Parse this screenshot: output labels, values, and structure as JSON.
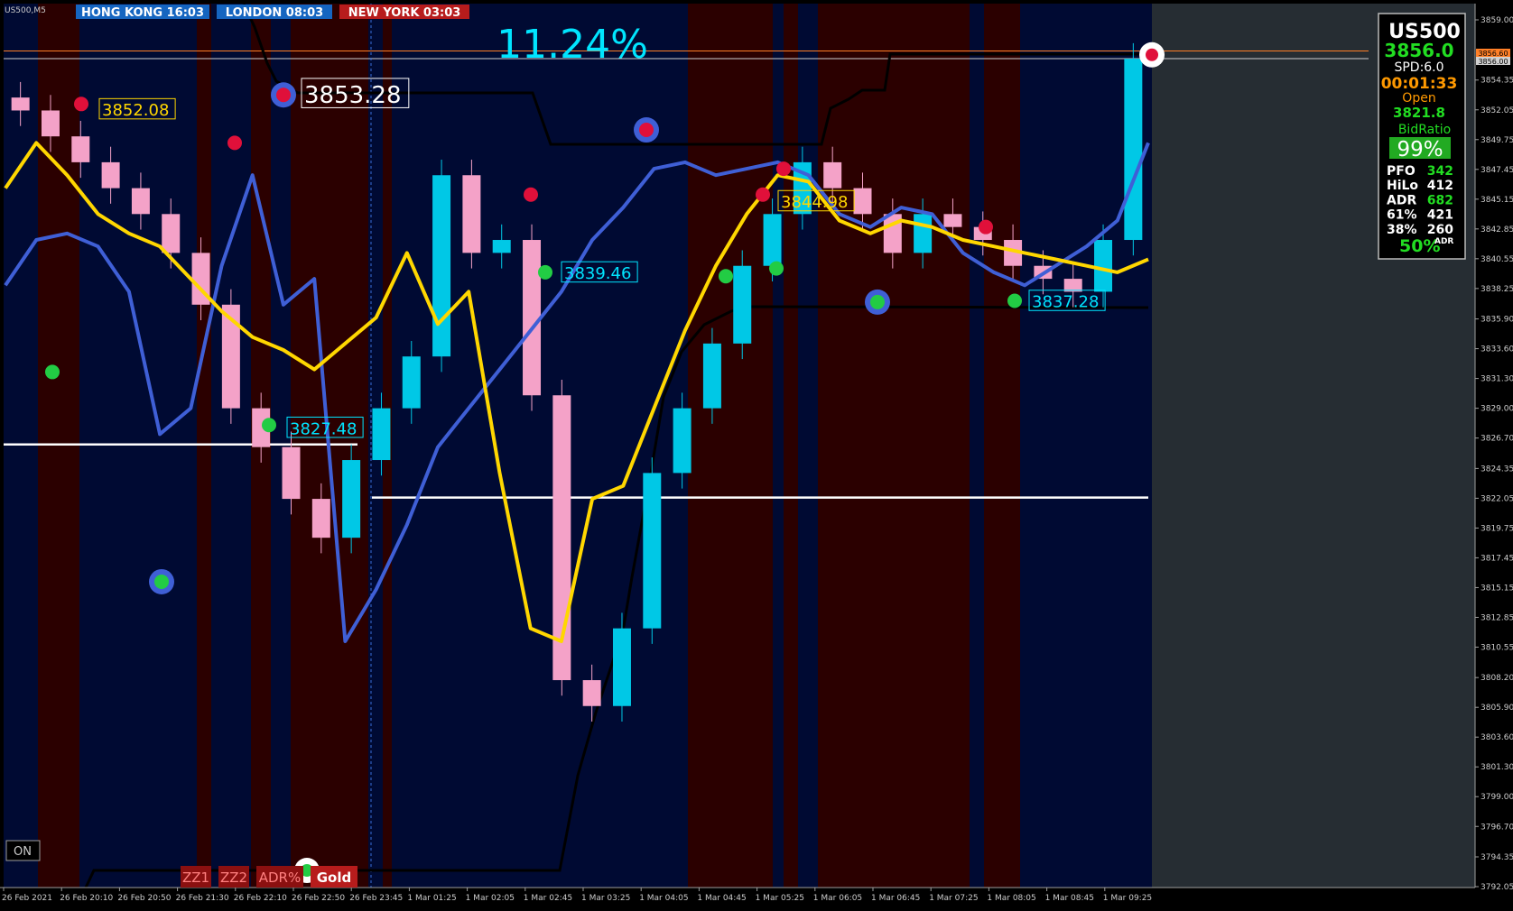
{
  "window": {
    "symbol_title": "US500,M5"
  },
  "sessions": [
    {
      "label": "HONG KONG 16:03",
      "color": "#1565c0"
    },
    {
      "label": "LONDON 08:03",
      "color": "#1565c0"
    },
    {
      "label": "NEW YORK 03:03",
      "color": "#b71c1c"
    }
  ],
  "big_percent": "11.24%",
  "info_panel": {
    "symbol": "US500",
    "price": "3856.0",
    "spread": "SPD:6.0",
    "timer": "00:01:33",
    "open_label": "Open",
    "open_value": "3821.8",
    "bidratio_label": "BidRatio",
    "bidratio_value": "99%",
    "rows": [
      {
        "label": "PFO",
        "value": "342"
      },
      {
        "label": "HiLo",
        "value": "412"
      },
      {
        "label": "ADR",
        "value": "682"
      },
      {
        "label": "61%",
        "value": "421"
      },
      {
        "label": "38%",
        "value": "260"
      }
    ],
    "adr_percent": "50%",
    "adr_sup": "ADR"
  },
  "buttons": {
    "on": "ON",
    "zz1": "ZZ1",
    "zz2": "ZZ2",
    "adr": "ADR%",
    "gold": "Gold"
  },
  "price_tags": [
    {
      "text": "3852.08",
      "color": "#ffd700"
    },
    {
      "text": "3853.28",
      "color": "#ffffff"
    },
    {
      "text": "3827.48",
      "color": "#00e5ff"
    },
    {
      "text": "3839.46",
      "color": "#00e5ff"
    },
    {
      "text": "3844.98",
      "color": "#ffd700"
    },
    {
      "text": "3837.28",
      "color": "#00e5ff"
    }
  ],
  "price_axis": {
    "labels": [
      "3859.00",
      "3856.60",
      "3856.00",
      "3854.35",
      "3852.05",
      "3849.75",
      "3847.45",
      "3845.15",
      "3842.85",
      "3840.55",
      "3838.25",
      "3835.90",
      "3833.60",
      "3831.30",
      "3829.00",
      "3826.70",
      "3824.35",
      "3822.05",
      "3819.75",
      "3817.45",
      "3815.15",
      "3812.85",
      "3810.55",
      "3808.20",
      "3805.90",
      "3803.60",
      "3801.30",
      "3799.00",
      "3796.70",
      "3794.35",
      "3792.05"
    ],
    "ask_tag": "3856.60",
    "bid_tag": "3856.00"
  },
  "time_axis": [
    "26 Feb 2021",
    "26 Feb 20:10",
    "26 Feb 20:50",
    "26 Feb 21:30",
    "26 Feb 22:10",
    "26 Feb 22:50",
    "26 Feb 23:45",
    "1 Mar 01:25",
    "1 Mar 02:05",
    "1 Mar 02:45",
    "1 Mar 03:25",
    "1 Mar 04:05",
    "1 Mar 04:45",
    "1 Mar 05:25",
    "1 Mar 06:05",
    "1 Mar 06:45",
    "1 Mar 07:25",
    "1 Mar 08:05",
    "1 Mar 08:45",
    "1 Mar 09:25"
  ],
  "chart_data": {
    "type": "candlestick",
    "ylim": [
      3792.05,
      3859.0
    ],
    "yellow_ma": [
      3846,
      3849.5,
      3847,
      3844,
      3842.5,
      3841.5,
      3839,
      3836.5,
      3834.5,
      3833.5,
      3832,
      3834,
      3836,
      3841,
      3835.5,
      3838,
      3824,
      3812,
      3811,
      3822,
      3823,
      3829,
      3835,
      3840,
      3844,
      3847,
      3846.5,
      3843.5,
      3842.5,
      3843.5,
      3843,
      3842,
      3841.5,
      3841,
      3840.5,
      3840,
      3839.5,
      3840.5
    ],
    "blue_ma": [
      3838.5,
      3842,
      3842.5,
      3841.5,
      3838,
      3827,
      3829,
      3840,
      3847,
      3837,
      3839,
      3811,
      3815,
      3820,
      3826,
      3829,
      3832,
      3835,
      3838,
      3842,
      3844.5,
      3847.5,
      3848,
      3847,
      3847.5,
      3848,
      3847,
      3844,
      3843,
      3844.5,
      3844,
      3841,
      3839.5,
      3838.5,
      3840,
      3841.5,
      3843.5,
      3849.5
    ],
    "closes": [
      3852,
      3850,
      3848,
      3846,
      3844,
      3841,
      3837,
      3829,
      3826,
      3822,
      3819,
      3825,
      3829,
      3833,
      3847,
      3841,
      3842,
      3830,
      3808,
      3806,
      3812,
      3824,
      3829,
      3834,
      3840,
      3844,
      3848,
      3846,
      3844,
      3841,
      3844,
      3843,
      3842,
      3840,
      3839,
      3838,
      3842,
      3856
    ]
  }
}
